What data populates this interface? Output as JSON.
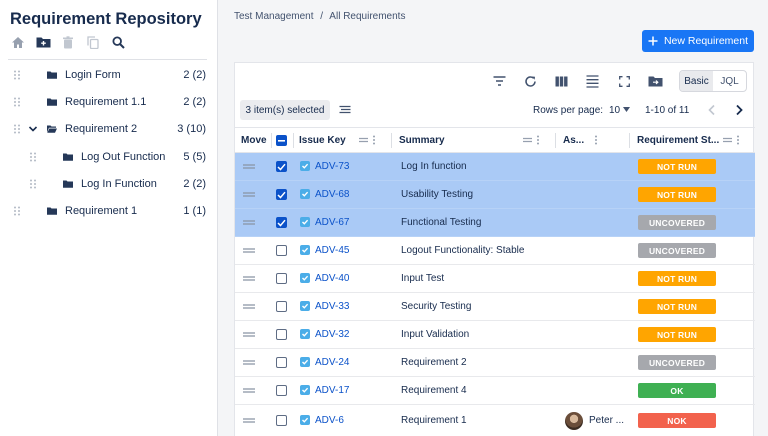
{
  "sidebar": {
    "title": "Requirement Repository",
    "toolbar_icons": [
      "home-icon",
      "new-folder-icon",
      "trash-icon",
      "copy-icon",
      "search-icon"
    ],
    "tree": [
      {
        "label": "Login Form",
        "count": "2 (2)",
        "level": 0,
        "expanded": false
      },
      {
        "label": "Requirement 1.1",
        "count": "2 (2)",
        "level": 0,
        "expanded": false
      },
      {
        "label": "Requirement 2",
        "count": "3 (10)",
        "level": 0,
        "expanded": true
      },
      {
        "label": "Log Out Function",
        "count": "5 (5)",
        "level": 1,
        "expanded": false
      },
      {
        "label": "Log In Function",
        "count": "2 (2)",
        "level": 1,
        "expanded": false
      },
      {
        "label": "Requirement 1",
        "count": "1 (1)",
        "level": 0,
        "expanded": false
      }
    ]
  },
  "breadcrumb": {
    "root": "Test Management",
    "separator": "/",
    "current": "All Requirements"
  },
  "header": {
    "new_button_label": "New Requirement"
  },
  "toolbar": {
    "icons": [
      "filter-icon",
      "refresh-icon",
      "columns-icon",
      "rows-icon",
      "fullscreen-icon",
      "move-to-folder-icon"
    ],
    "mode_basic": "Basic",
    "mode_jql": "JQL",
    "active_mode": "Basic"
  },
  "selection": {
    "label": "3 item(s) selected"
  },
  "pagination": {
    "rows_per_page_label": "Rows per page:",
    "rows_per_page": "10",
    "range": "1-10 of 11"
  },
  "table": {
    "columns": {
      "move": "Move",
      "issue_key": "Issue Key",
      "summary": "Summary",
      "assignee": "As...",
      "status": "Requirement St..."
    },
    "rows": [
      {
        "key": "ADV-73",
        "summary": "Log In function",
        "assignee": "",
        "status": "NOT RUN",
        "selected": true
      },
      {
        "key": "ADV-68",
        "summary": "Usability Testing",
        "assignee": "",
        "status": "NOT RUN",
        "selected": true
      },
      {
        "key": "ADV-67",
        "summary": "Functional Testing",
        "assignee": "",
        "status": "UNCOVERED",
        "selected": true
      },
      {
        "key": "ADV-45",
        "summary": "Logout Functionality: Stable",
        "assignee": "",
        "status": "UNCOVERED",
        "selected": false
      },
      {
        "key": "ADV-40",
        "summary": "Input Test",
        "assignee": "",
        "status": "NOT RUN",
        "selected": false
      },
      {
        "key": "ADV-33",
        "summary": "Security Testing",
        "assignee": "",
        "status": "NOT RUN",
        "selected": false
      },
      {
        "key": "ADV-32",
        "summary": "Input Validation",
        "assignee": "",
        "status": "NOT RUN",
        "selected": false
      },
      {
        "key": "ADV-24",
        "summary": "Requirement 2",
        "assignee": "",
        "status": "UNCOVERED",
        "selected": false
      },
      {
        "key": "ADV-17",
        "summary": "Requirement 4",
        "assignee": "",
        "status": "OK",
        "selected": false
      },
      {
        "key": "ADV-6",
        "summary": "Requirement 1",
        "assignee": "Peter ...",
        "status": "NOK",
        "selected": false
      }
    ]
  },
  "colors": {
    "primary": "#1976f5",
    "selected_row": "#aacaf6",
    "not_run": "#ffa500",
    "uncovered": "#a6a8ad",
    "ok": "#3fb053",
    "nok": "#f2624d",
    "link": "#0b52c9"
  }
}
